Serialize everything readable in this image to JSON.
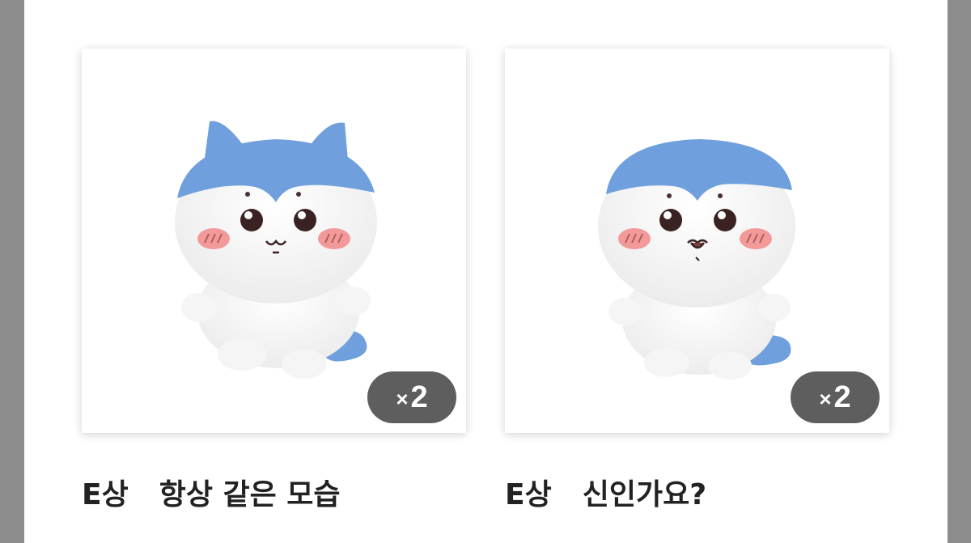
{
  "items": [
    {
      "grade": "E상",
      "name": "항상 같은 모습",
      "qty_prefix": "×",
      "qty": "2",
      "image_icon": "hachiware-plush-with-ears"
    },
    {
      "grade": "E상",
      "name": "신인가요?",
      "qty_prefix": "×",
      "qty": "2",
      "image_icon": "hachiware-plush-no-ears"
    }
  ],
  "colors": {
    "plush_blue": "#6f9fdc",
    "plush_white": "#ffffff",
    "blush": "#f29a9a",
    "badge_bg": "#5e5e5e"
  }
}
